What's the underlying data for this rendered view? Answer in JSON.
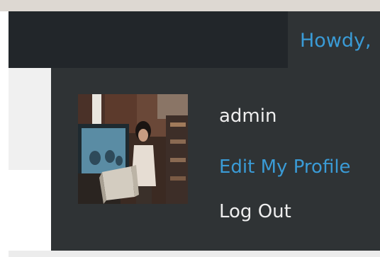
{
  "admin_bar": {
    "greeting": "Howdy,"
  },
  "user_menu": {
    "display_name": "admin",
    "edit_profile_label": "Edit My Profile",
    "logout_label": "Log Out",
    "avatar_icon": "user-avatar-photo"
  },
  "colors": {
    "admin_bar_bg": "#22262a",
    "menu_bg": "#2f3335",
    "link_blue": "#3a9bd6",
    "text_light": "#eeeeee"
  }
}
